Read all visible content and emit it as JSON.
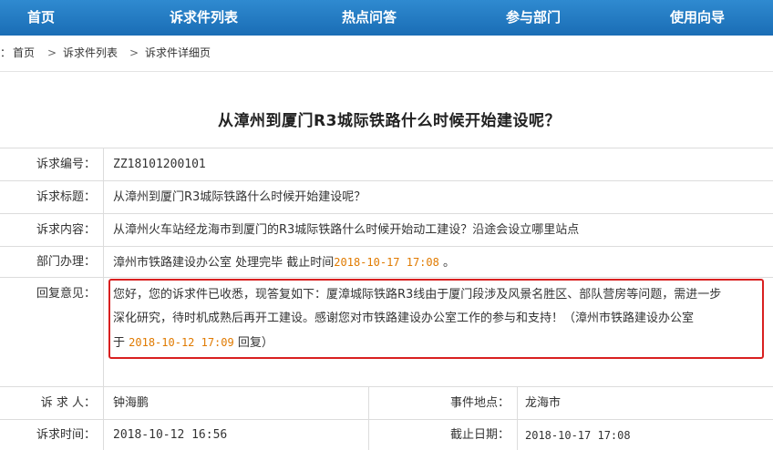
{
  "nav": {
    "items": [
      "首页",
      "诉求件列表",
      "热点问答",
      "参与部门",
      "使用向导"
    ],
    "bg_color": "#1f74bb"
  },
  "breadcrumb": {
    "prefix": "：",
    "items": [
      "首页",
      "诉求件列表",
      "诉求件详细页"
    ],
    "separator": ">"
  },
  "title": "从漳州到厦门R3城际铁路什么时候开始建设呢？",
  "fields": {
    "id_label": "诉求编号：",
    "id_value": "ZZ18101200101",
    "subject_label": "诉求标题：",
    "subject_value": "从漳州到厦门R3城际铁路什么时候开始建设呢？",
    "content_label": "诉求内容：",
    "content_value": "从漳州火车站经龙海市到厦门的R3城际铁路什么时候开始动工建设？沿途会设立哪里站点",
    "dept_label": "部门办理：",
    "dept_value_prefix": "漳州市铁路建设办公室 处理完毕 截止时间",
    "dept_deadline": "2018-10-17 17:08",
    "dept_value_suffix": " 。",
    "reply_label": "回复意见：",
    "reply_line1": "您好，您的诉求件已收悉，现答复如下：厦漳城际铁路R3线由于厦门段涉及风景名胜区、部队营房等问题，需进一步",
    "reply_line2": "深化研究，待时机成熟后再开工建设。感谢您对市铁路建设办公室工作的参与和支持！（漳州市铁路建设办公室",
    "reply_line3_prefix": "于 ",
    "reply_time": "2018-10-12 17:09",
    "reply_line3_suffix": " 回复）",
    "petitioner_label": "诉 求 人：",
    "petitioner_value": "钟海鹏",
    "location_label": "事件地点：",
    "location_value": "龙海市",
    "time_label": "诉求时间：",
    "time_value": "2018-10-12 16:56",
    "deadline_label": "截止日期：",
    "deadline_value": "2018-10-17 17:08"
  },
  "colors": {
    "highlight_border": "#d92020",
    "date_orange": "#e07a00"
  }
}
